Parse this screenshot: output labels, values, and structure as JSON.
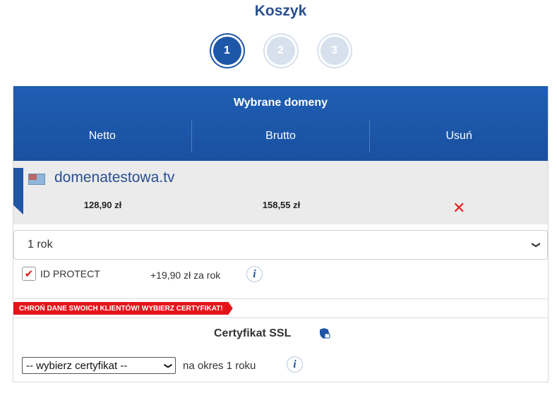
{
  "page": {
    "title": "Koszyk"
  },
  "steps": [
    "1",
    "2",
    "3"
  ],
  "table": {
    "title": "Wybrane domeny",
    "columns": [
      "Netto",
      "Brutto",
      "Usuń"
    ]
  },
  "domain": {
    "name": "domenatestowa.tv",
    "netto": "128,90 zł",
    "brutto": "158,55 zł",
    "remove_icon": "close-icon"
  },
  "period": {
    "value": "1 rok"
  },
  "id_protect": {
    "label": "ID PROTECT",
    "checked": true,
    "price": "+19,90 zł za rok"
  },
  "banner": {
    "text": "CHROŃ DANE SWOICH KLIENTÓW! WYBIERZ CERTYFIKAT!"
  },
  "ssl": {
    "title": "Certyfikat SSL",
    "select_value": "-- wybierz certyfikat --",
    "period_text": "na okres 1 roku"
  },
  "colors": {
    "primary": "#1f5eb3",
    "danger": "#e4141b",
    "title": "#2a4f8f"
  }
}
